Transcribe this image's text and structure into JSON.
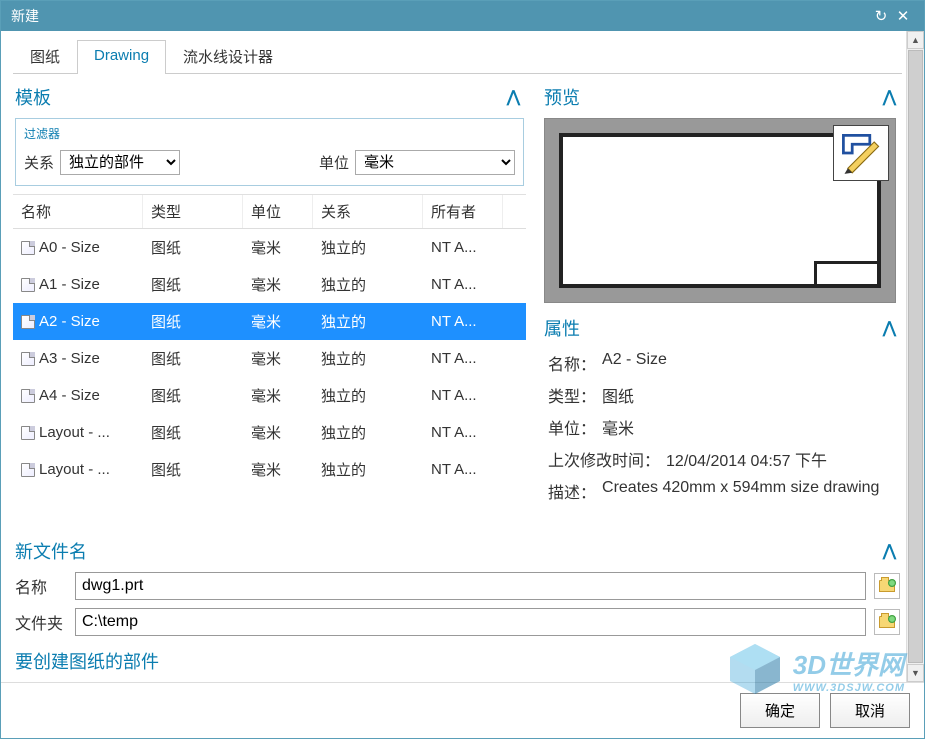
{
  "window": {
    "title": "新建"
  },
  "tabs": [
    {
      "label": "图纸",
      "active": false
    },
    {
      "label": "Drawing",
      "active": true
    },
    {
      "label": "流水线设计器",
      "active": false
    }
  ],
  "templates": {
    "header": "模板",
    "filter": {
      "title": "过滤器",
      "relation_label": "关系",
      "relation_value": "独立的部件",
      "unit_label": "单位",
      "unit_value": "毫米"
    },
    "columns": {
      "name": "名称",
      "type": "类型",
      "unit": "单位",
      "relation": "关系",
      "owner": "所有者"
    },
    "rows": [
      {
        "name": "A0 - Size",
        "type": "图纸",
        "unit": "毫米",
        "relation": "独立的",
        "owner": "NT A..."
      },
      {
        "name": "A1 - Size",
        "type": "图纸",
        "unit": "毫米",
        "relation": "独立的",
        "owner": "NT A..."
      },
      {
        "name": "A2 - Size",
        "type": "图纸",
        "unit": "毫米",
        "relation": "独立的",
        "owner": "NT A..."
      },
      {
        "name": "A3 - Size",
        "type": "图纸",
        "unit": "毫米",
        "relation": "独立的",
        "owner": "NT A..."
      },
      {
        "name": "A4 - Size",
        "type": "图纸",
        "unit": "毫米",
        "relation": "独立的",
        "owner": "NT A..."
      },
      {
        "name": "Layout - ...",
        "type": "图纸",
        "unit": "毫米",
        "relation": "独立的",
        "owner": "NT A..."
      },
      {
        "name": "Layout - ...",
        "type": "图纸",
        "unit": "毫米",
        "relation": "独立的",
        "owner": "NT A..."
      }
    ],
    "selected_index": 2
  },
  "preview": {
    "header": "预览"
  },
  "properties": {
    "header": "属性",
    "name_label": "名称：",
    "name_value": "A2 - Size",
    "type_label": "类型：",
    "type_value": "图纸",
    "unit_label": "单位：",
    "unit_value": "毫米",
    "modified_label": "上次修改时间：",
    "modified_value": "12/04/2014 04:57 下午",
    "desc_label": "描述：",
    "desc_value": "Creates 420mm x 594mm size drawing"
  },
  "newfile": {
    "header": "新文件名",
    "name_label": "名称",
    "name_value": "dwg1.prt",
    "folder_label": "文件夹",
    "folder_value": "C:\\temp"
  },
  "truncated_section": "要创建图纸的部件",
  "buttons": {
    "ok": "确定",
    "cancel": "取消"
  },
  "watermark": {
    "main": "3D世界网",
    "sub": "WWW.3DSJW.COM"
  }
}
